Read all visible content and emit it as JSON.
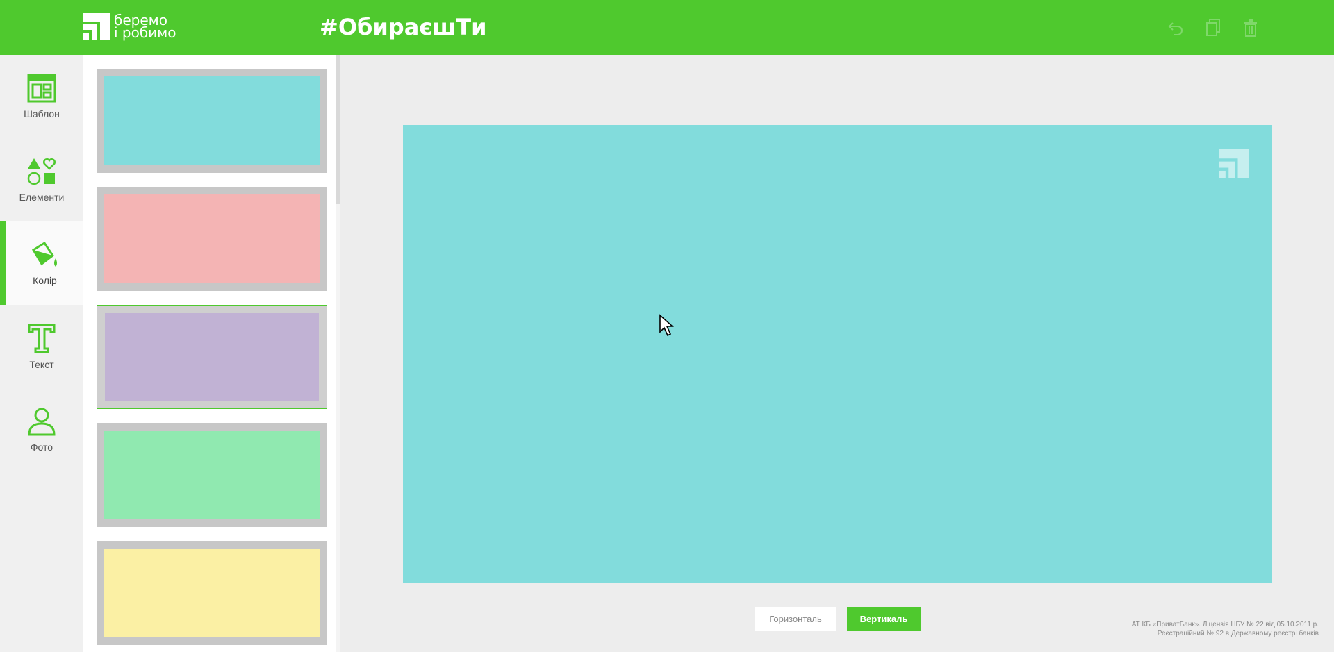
{
  "header": {
    "logo_line1": "беремо",
    "logo_line2": "і робимо",
    "hashtag": "#ОбираєшТи",
    "tools": [
      {
        "icon": "undo-icon"
      },
      {
        "icon": "copy-icon"
      },
      {
        "icon": "trash-icon"
      }
    ]
  },
  "rail": {
    "items": [
      {
        "label": "Шаблон",
        "icon": "template-icon"
      },
      {
        "label": "Елементи",
        "icon": "shapes-icon"
      },
      {
        "label": "Колір",
        "icon": "paint-bucket-icon",
        "active": true
      },
      {
        "label": "Текст",
        "icon": "text-icon"
      },
      {
        "label": "Фото",
        "icon": "user-icon"
      }
    ]
  },
  "swatches": [
    {
      "color": "#82dcdc"
    },
    {
      "color": "#f4b4b4"
    },
    {
      "color": "#c1b2d4",
      "selected": true
    },
    {
      "color": "#90e9b0"
    },
    {
      "color": "#fbf0a4"
    }
  ],
  "canvas": {
    "background": "#82dcdc",
    "logo_icon": "privatbank-logo-icon"
  },
  "buttons": {
    "horizontal": "Горизонталь",
    "vertical": "Вертикаль"
  },
  "legal": {
    "line1": "АТ КБ «ПриватБанк». Ліцензія НБУ № 22 від 05.10.2011 р.",
    "line2": "Реєстраційний № 92 в Державному реєстрі банків"
  },
  "colors": {
    "accent": "#4fc92e"
  }
}
